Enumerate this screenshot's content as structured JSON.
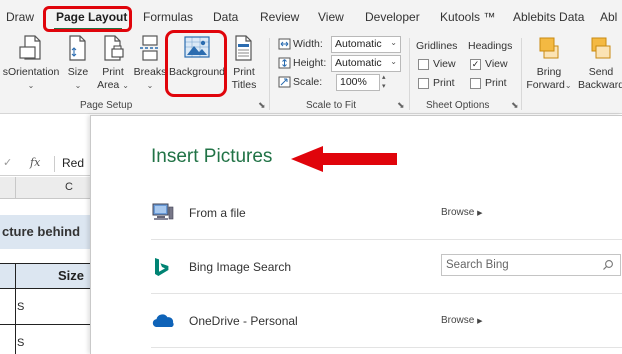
{
  "tabs": [
    {
      "label": "Draw",
      "active": false
    },
    {
      "label": "Page Layout",
      "active": true
    },
    {
      "label": "Formulas",
      "active": false
    },
    {
      "label": "Data",
      "active": false
    },
    {
      "label": "Review",
      "active": false
    },
    {
      "label": "View",
      "active": false
    },
    {
      "label": "Developer",
      "active": false
    },
    {
      "label": "Kutools ™",
      "active": false
    },
    {
      "label": "Ablebits Data",
      "active": false
    },
    {
      "label": "Abl",
      "active": false
    }
  ],
  "ribbon": {
    "page_setup": {
      "label": "Page Setup",
      "buttons": {
        "orientation": "Orientation",
        "size": "Size",
        "print_area_1": "Print",
        "print_area_2": "Area",
        "breaks": "Breaks",
        "background": "Background",
        "print_titles_1": "Print",
        "print_titles_2": "Titles"
      },
      "orientation_prefix": "s"
    },
    "scale_to_fit": {
      "label": "Scale to Fit",
      "width_label": "Width:",
      "width_value": "Automatic",
      "height_label": "Height:",
      "height_value": "Automatic",
      "scale_label": "Scale:",
      "scale_value": "100%"
    },
    "sheet_options": {
      "label": "Sheet Options",
      "gridlines": {
        "title": "Gridlines",
        "view_label": "View",
        "view_checked": false,
        "print_label": "Print",
        "print_checked": false
      },
      "headings": {
        "title": "Headings",
        "view_label": "View",
        "view_checked": true,
        "print_label": "Print",
        "print_checked": false
      }
    },
    "arrange": {
      "bring_forward_1": "Bring",
      "bring_forward_2": "Forward",
      "send_backward_1": "Send",
      "send_backward_2": "Backward"
    }
  },
  "sheet": {
    "formula_fx": "fx",
    "formula_value": "Red",
    "column_c": "C",
    "title_fragment": "cture behind",
    "size_header": "Size",
    "cell_s1": "S",
    "cell_s2": "S"
  },
  "dialog": {
    "title": "Insert Pictures",
    "rows": [
      {
        "label": "From a file",
        "action": "Browse"
      },
      {
        "label": "Bing Image Search",
        "search_placeholder": "Search Bing"
      },
      {
        "label": "OneDrive - Personal",
        "action": "Browse"
      }
    ]
  },
  "colors": {
    "accent_green": "#217346",
    "highlight_red": "#e0040b",
    "bing_teal": "#008373",
    "onedrive_blue": "#0f63b8"
  }
}
